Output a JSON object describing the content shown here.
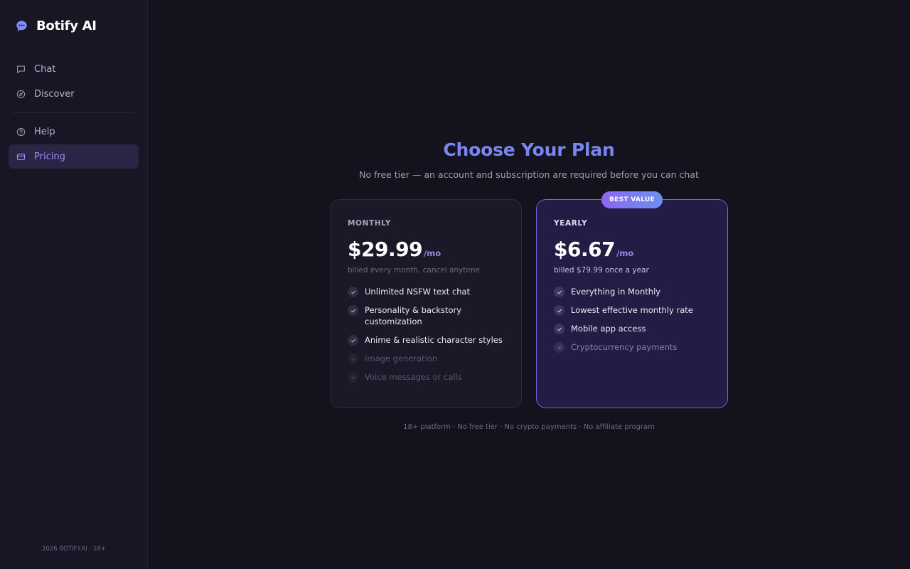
{
  "brand": {
    "name": "Botify AI",
    "icon": "chat-bubble-icon"
  },
  "sidebar": {
    "items": [
      {
        "label": "Chat",
        "icon": "chat-icon",
        "active": false
      },
      {
        "label": "Discover",
        "icon": "compass-icon",
        "active": false
      },
      {
        "label": "Help",
        "icon": "help-circle-icon",
        "active": false
      },
      {
        "label": "Pricing",
        "icon": "credit-card-icon",
        "active": true
      }
    ],
    "footer": "2026 BOTIFY.AI · 18+"
  },
  "main": {
    "title": "Choose Your Plan",
    "subtitle": "No free tier — an account and subscription are required before you can chat",
    "plans": [
      {
        "name": "MONTHLY",
        "price": "$29.99",
        "period": "/mo",
        "billing": "billed every month, cancel anytime",
        "features": [
          {
            "text": "Unlimited NSFW text chat",
            "included": true
          },
          {
            "text": "Personality & backstory customization",
            "included": true
          },
          {
            "text": "Anime & realistic character styles",
            "included": true
          },
          {
            "text": "Image generation",
            "included": false
          },
          {
            "text": "Voice messages or calls",
            "included": false
          }
        ]
      },
      {
        "name": "YEARLY",
        "badge": "BEST VALUE",
        "price": "$6.67",
        "period": "/mo",
        "billing": "billed $79.99 once a year",
        "features": [
          {
            "text": "Everything in Monthly",
            "included": true
          },
          {
            "text": "Lowest effective monthly rate",
            "included": true
          },
          {
            "text": "Mobile app access",
            "included": true
          },
          {
            "text": "Cryptocurrency payments",
            "included": false
          }
        ]
      }
    ],
    "footnote": "18+ platform · No free tier · No crypto payments · No affiliate program"
  },
  "colors": {
    "background": "#14121d",
    "sidebar": "#181524",
    "accent": "#7a86f0",
    "active_nav": "#a48bf7",
    "highlight_border": "#7b5fe0"
  }
}
